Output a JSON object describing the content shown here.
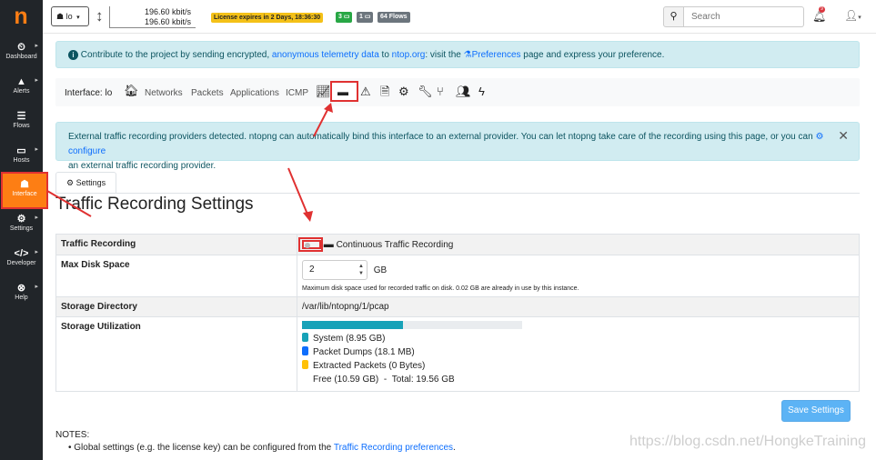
{
  "sidebar": {
    "logo": "n",
    "items": [
      {
        "label": "Dashboard",
        "icon": "dashboard-icon",
        "glyph": "⏲"
      },
      {
        "label": "Alerts",
        "icon": "alert-icon",
        "glyph": "▲"
      },
      {
        "label": "Flows",
        "icon": "flows-icon",
        "glyph": "☰"
      },
      {
        "label": "Hosts",
        "icon": "hosts-icon",
        "glyph": "▭"
      },
      {
        "label": "Interface",
        "icon": "interface-icon",
        "glyph": "☗"
      },
      {
        "label": "Settings",
        "icon": "settings-icon",
        "glyph": "⚙"
      },
      {
        "label": "Developer",
        "icon": "developer-icon",
        "glyph": "</>"
      },
      {
        "label": "Help",
        "icon": "help-icon",
        "glyph": "⊗"
      }
    ]
  },
  "topbar": {
    "interface": "lo",
    "rx": "196.60 kbit/s",
    "tx": "196.60 kbit/s",
    "license": "License expires in 2 Days, 18:36:30",
    "badge_alerts": "3",
    "badge_devices": "1",
    "badge_flows": "64 Flows",
    "search_placeholder": "Search",
    "notif_count": "9"
  },
  "telemetry": {
    "prefix": "Contribute to the project by sending encrypted,",
    "link1": "anonymous telemetry data",
    "mid": "to",
    "link2": "ntop.org",
    "mid2": ": visit the",
    "link3": "Preferences",
    "suffix": "page and express your preference."
  },
  "iface_nav": {
    "label": "Interface: lo",
    "links": [
      "Networks",
      "Packets",
      "Applications",
      "ICMP"
    ]
  },
  "provider": {
    "text1": "External traffic recording providers detected. ntopng can automatically bind this interface to an external provider. You can let ntopng take care of the recording using this page, or you can",
    "link": "configure",
    "text2": "an external traffic recording provider."
  },
  "tab_settings": "Settings",
  "page_title": "Traffic Recording Settings",
  "table": {
    "rows": [
      {
        "key": "Traffic Recording",
        "value": "Continuous Traffic Recording"
      },
      {
        "key": "Max Disk Space",
        "value": "2",
        "unit": "GB",
        "note": "Maximum disk space used for recorded traffic on disk. 0.02 GB are already in use by this instance."
      },
      {
        "key": "Storage Directory",
        "value": "/var/lib/ntopng/1/pcap"
      },
      {
        "key": "Storage Utilization"
      }
    ],
    "utilization": {
      "used_fraction": 0.46,
      "legend": [
        {
          "label": "System (8.95 GB)",
          "color": "#17a2b8"
        },
        {
          "label": "Packet Dumps (18.1 MB)",
          "color": "#0d6efd"
        },
        {
          "label": "Extracted Packets (0 Bytes)",
          "color": "#ffc107"
        }
      ],
      "free": "Free (10.59 GB)",
      "sep": "-",
      "total": "Total: 19.56 GB"
    }
  },
  "save_label": "Save Settings",
  "notes": {
    "title": "NOTES:",
    "item_prefix": "Global settings (e.g. the license key) can be configured from the",
    "item_link": "Traffic Recording preferences",
    "item_suffix": "."
  },
  "watermark": "https://blog.csdn.net/HongkeTraining"
}
